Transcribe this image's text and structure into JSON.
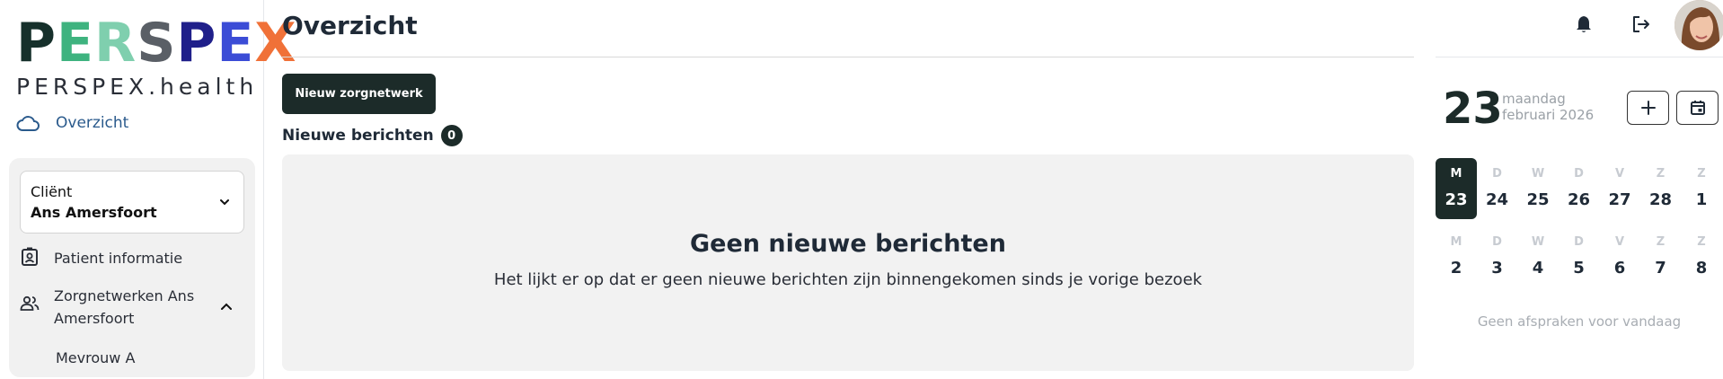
{
  "logo": {
    "letters": [
      {
        "char": "P",
        "color": "#16302b"
      },
      {
        "char": "E",
        "color": "#3eb37f"
      },
      {
        "char": "R",
        "color": "#7fcfae"
      },
      {
        "char": "S",
        "color": "#5a5f66"
      },
      {
        "char": "P",
        "color": "#1f1f8a"
      },
      {
        "char": "E",
        "color": "#3b4cd6"
      },
      {
        "char": "X",
        "color": "#f07138"
      }
    ],
    "subtitle": "PERSPEX.health"
  },
  "sidebar": {
    "overview_label": "Overzicht",
    "client": {
      "label": "Cliënt",
      "value": "Ans Amersfoort"
    },
    "items": [
      {
        "label": "Patient informatie",
        "icon": "id-badge-icon"
      },
      {
        "label": "Zorgnetwerken Ans Amersfoort",
        "icon": "people-icon"
      },
      {
        "label": "Mevrouw A",
        "icon": ""
      }
    ]
  },
  "main": {
    "title": "Overzicht",
    "new_button": "Nieuw zorgnetwerk",
    "messages_header": "Nieuwe berichten",
    "messages_count": "0",
    "empty_title": "Geen nieuwe berichten",
    "empty_text": "Het lijkt er op dat er geen nieuwe berichten zijn binnengekomen sinds je vorige bezoek"
  },
  "calendar": {
    "day_number": "23",
    "weekday": "maandag",
    "month_year": "februari 2026",
    "weeks": [
      [
        {
          "l": "M",
          "d": "23",
          "active": true
        },
        {
          "l": "D",
          "d": "24"
        },
        {
          "l": "W",
          "d": "25"
        },
        {
          "l": "D",
          "d": "26"
        },
        {
          "l": "V",
          "d": "27"
        },
        {
          "l": "Z",
          "d": "28"
        },
        {
          "l": "Z",
          "d": "1"
        }
      ],
      [
        {
          "l": "M",
          "d": "2"
        },
        {
          "l": "D",
          "d": "3"
        },
        {
          "l": "W",
          "d": "4"
        },
        {
          "l": "D",
          "d": "5"
        },
        {
          "l": "V",
          "d": "6"
        },
        {
          "l": "Z",
          "d": "7"
        },
        {
          "l": "Z",
          "d": "8"
        }
      ]
    ],
    "no_appointments": "Geen afspraken voor vandaag"
  }
}
